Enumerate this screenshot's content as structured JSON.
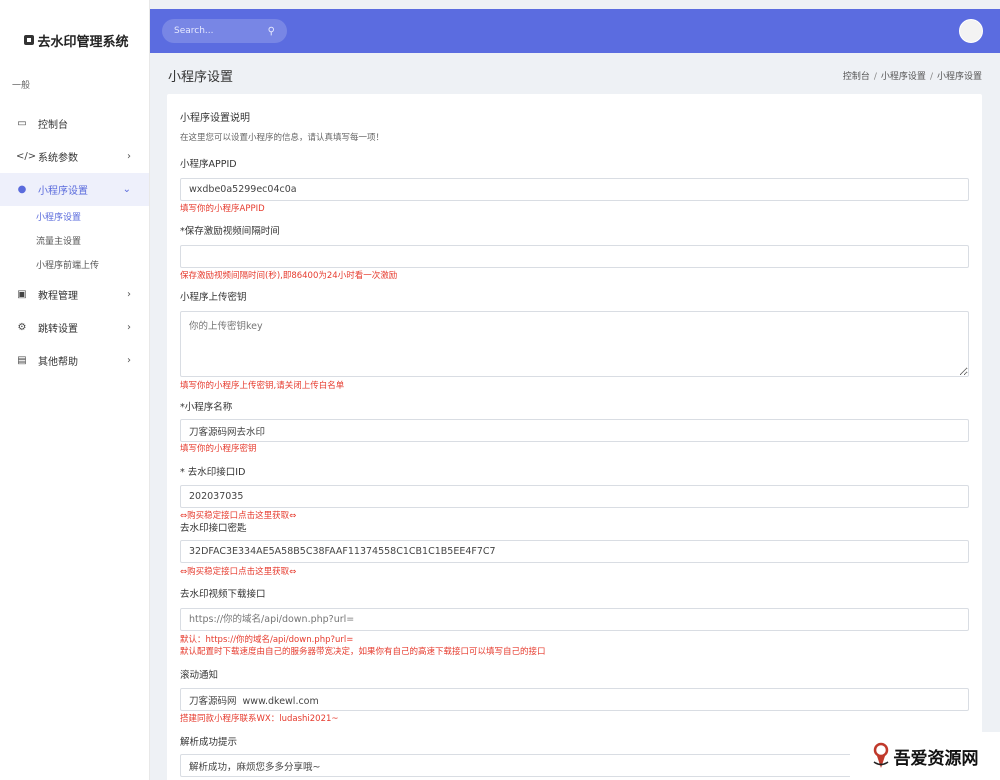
{
  "brand": {
    "title": "去水印管理系统"
  },
  "sidebar": {
    "section": "一般",
    "items": [
      {
        "label": "控制台",
        "icon": "monitor-icon"
      },
      {
        "label": "系统参数",
        "icon": "code-icon"
      },
      {
        "label": "小程序设置",
        "icon": "shield-icon",
        "sub": [
          "小程序设置",
          "流量主设置",
          "小程序前端上传"
        ]
      },
      {
        "label": "教程管理",
        "icon": "picture-icon"
      },
      {
        "label": "跳转设置",
        "icon": "settings-icon"
      },
      {
        "label": "其他帮助",
        "icon": "document-icon"
      }
    ]
  },
  "topbar": {
    "search_placeholder": "Search..."
  },
  "page": {
    "title": "小程序设置",
    "breadcrumb": [
      "控制台",
      "小程序设置",
      "小程序设置"
    ]
  },
  "card": {
    "title": "小程序设置说明",
    "desc": "在这里您可以设置小程序的信息，请认真填写每一项！"
  },
  "fields": {
    "appid": {
      "label": "小程序APPID",
      "value": "wxdbe0a5299ec04c0a",
      "help": "填写你的小程序APPID"
    },
    "interval": {
      "label": "*保存激励视频间隔时间",
      "value": "",
      "help": "保存激励视频间隔时间(秒),即86400为24小时看一次激励"
    },
    "upload_key": {
      "label": "小程序上传密钥",
      "placeholder": "你的上传密钥key",
      "help": "填写你的小程序上传密钥,请关闭上传白名单"
    },
    "name": {
      "label": "*小程序名称",
      "value": "刀客源码网去水印",
      "help": "填写你的小程序密钥"
    },
    "api_id": {
      "label": "* 去水印接口ID",
      "value": "202037035",
      "help": "⇔购买稳定接口点击这里获取⇔"
    },
    "api_key": {
      "label": "去水印接口密匙",
      "value": "32DFAC3E334AE5A58B5C38FAAF11374558C1CB1C1B5EE4F7C7",
      "help": "⇔购买稳定接口点击这里获取⇔"
    },
    "download_api": {
      "label": "去水印视频下载接口",
      "placeholder": "https://你的域名/api/down.php?url=",
      "help1": "默认：https://你的域名/api/down.php?url=",
      "help2": "默认配置时下载速度由自己的服务器带宽决定，如果你有自己的高速下载接口可以填写自己的接口"
    },
    "notice": {
      "label": "滚动通知",
      "value": "刀客源码网  www.dkewl.com",
      "help": "搭建同款小程序联系WX：ludashi2021~"
    },
    "success_tip": {
      "label": "解析成功提示",
      "value": "解析成功，麻烦您多多分享哦~"
    }
  },
  "watermark": {
    "text": "吾爱资源网"
  }
}
